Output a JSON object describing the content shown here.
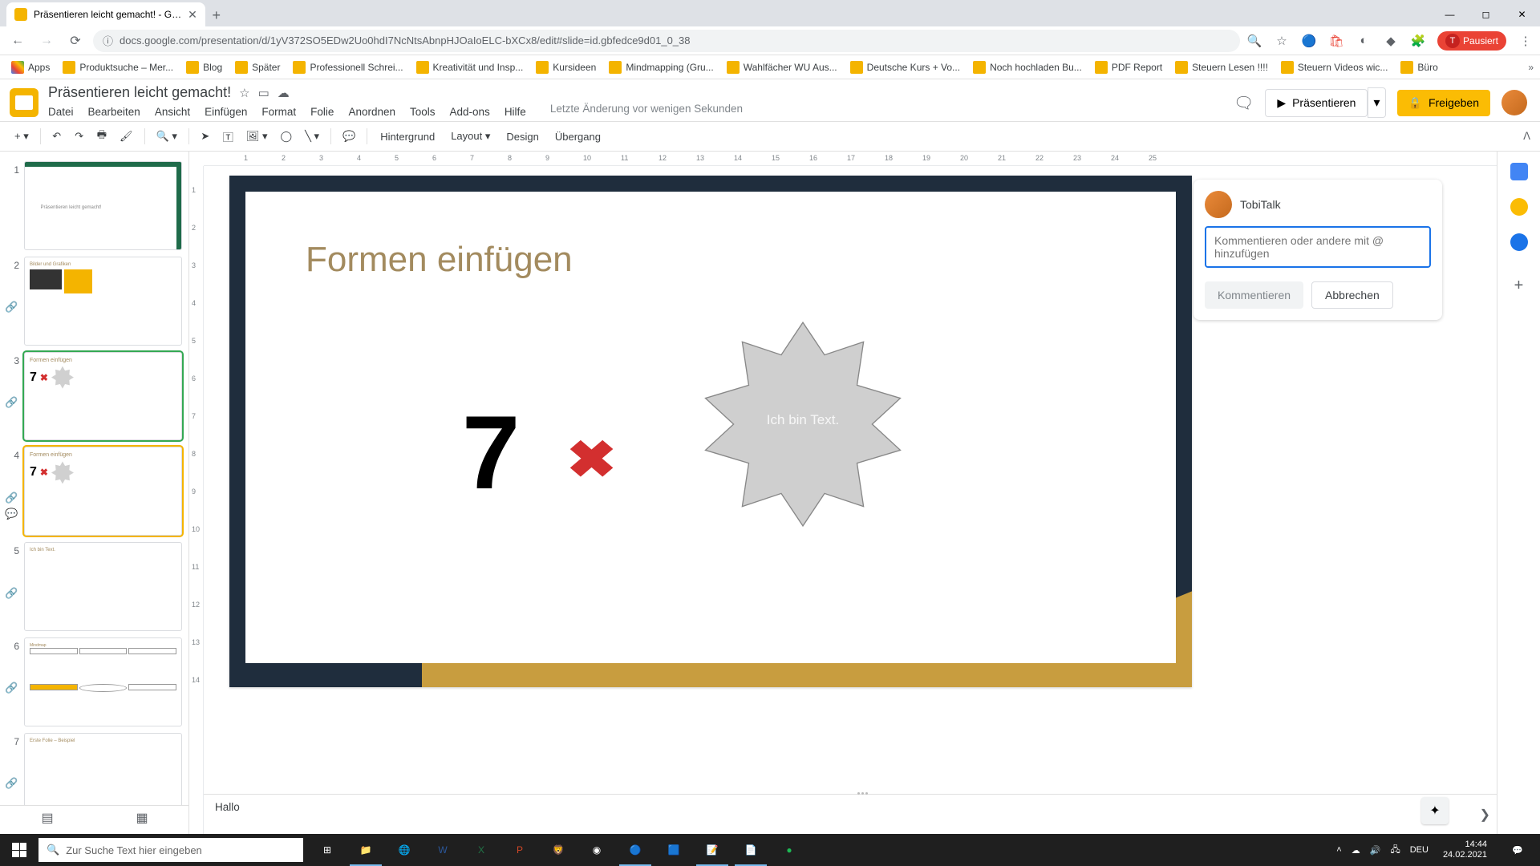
{
  "browser": {
    "tab_title": "Präsentieren leicht gemacht! - G…",
    "url": "docs.google.com/presentation/d/1yV372SO5EDw2Uo0hdI7NcNtsAbnpHJOaIoELC-bXCx8/edit#slide=id.gbfedce9d01_0_38",
    "profile_status": "Pausiert"
  },
  "bookmarks": {
    "apps": "Apps",
    "items": [
      "Produktsuche – Mer...",
      "Blog",
      "Später",
      "Professionell Schrei...",
      "Kreativität und Insp...",
      "Kursideen",
      "Mindmapping  (Gru...",
      "Wahlfächer WU Aus...",
      "Deutsche Kurs + Vo...",
      "Noch hochladen Bu...",
      "PDF Report",
      "Steuern Lesen !!!!",
      "Steuern Videos wic...",
      "Büro"
    ]
  },
  "doc": {
    "title": "Präsentieren leicht gemacht!",
    "menus": [
      "Datei",
      "Bearbeiten",
      "Ansicht",
      "Einfügen",
      "Format",
      "Folie",
      "Anordnen",
      "Tools",
      "Add-ons",
      "Hilfe"
    ],
    "last_edit": "Letzte Änderung vor wenigen Sekunden",
    "present": "Präsentieren",
    "share": "Freigeben"
  },
  "toolbar": {
    "background": "Hintergrund",
    "layout": "Layout",
    "design": "Design",
    "transition": "Übergang"
  },
  "ruler_h": [
    "1",
    "2",
    "3",
    "4",
    "5",
    "6",
    "7",
    "8",
    "9",
    "10",
    "11",
    "12",
    "13",
    "14",
    "15",
    "16",
    "17",
    "18",
    "19",
    "20",
    "21",
    "22",
    "23",
    "24",
    "25"
  ],
  "ruler_v": [
    "1",
    "2",
    "3",
    "4",
    "5",
    "6",
    "7",
    "8",
    "9",
    "10",
    "11",
    "12",
    "13",
    "14"
  ],
  "slide": {
    "title": "Formen einfügen",
    "big_number": "7",
    "x_mark": "✖",
    "shape_text": "Ich bin Text."
  },
  "notes": "Hallo",
  "comment": {
    "author": "TobiTalk",
    "placeholder": "Kommentieren oder andere mit @ hinzufügen",
    "submit": "Kommentieren",
    "cancel": "Abbrechen"
  },
  "thumbs": {
    "t1": "Präsentieren leicht gemacht!",
    "t2": "Bilder und Grafiken",
    "t3": "Formen einfügen",
    "t4": "Formen einfügen",
    "t5": "Ich bin Text.",
    "t6": "Mindmap",
    "t7": "Erste Folie – Beispiel"
  },
  "taskbar": {
    "search_placeholder": "Zur Suche Text hier eingeben",
    "lang": "DEU",
    "time": "14:44",
    "date": "24.02.2021"
  }
}
